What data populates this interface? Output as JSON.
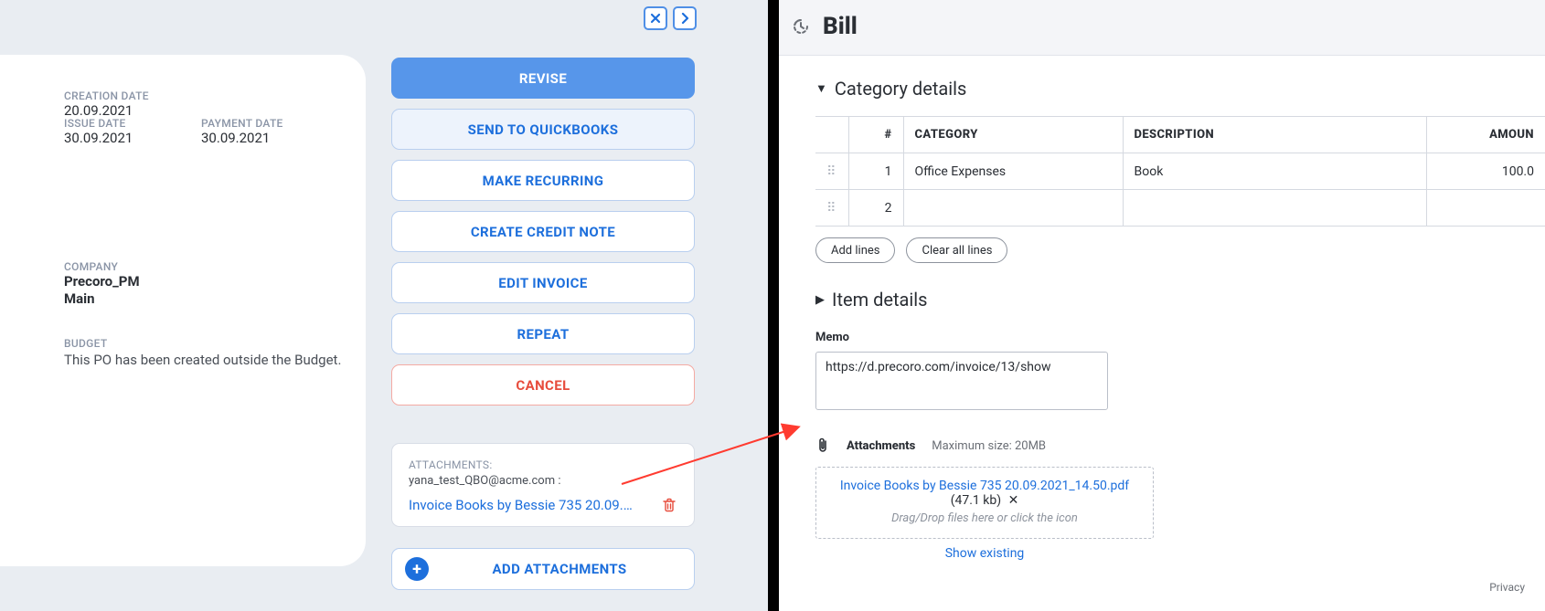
{
  "left": {
    "dates": {
      "creation_label": "CREATION DATE",
      "creation_value": "20.09.2021",
      "issue_label": "ISSUE DATE",
      "issue_value": "30.09.2021",
      "payment_label": "PAYMENT DATE",
      "payment_value": "30.09.2021"
    },
    "company_label": "COMPANY",
    "company_line1": "Precoro_PM",
    "company_line2": "Main",
    "budget_label": "BUDGET",
    "budget_text": "This PO has been created outside the Budget.",
    "actions": {
      "revise": "REVISE",
      "send_qb": "SEND TO QUICKBOOKS",
      "make_recurring": "MAKE RECURRING",
      "create_credit_note": "CREATE CREDIT NOTE",
      "edit_invoice": "EDIT INVOICE",
      "repeat": "REPEAT",
      "cancel": "CANCEL"
    },
    "attachments": {
      "title": "ATTACHMENTS:",
      "user": "yana_test_QBO@acme.com :",
      "file": "Invoice Books by Bessie 735 20.09.202...",
      "add_label": "ADD ATTACHMENTS"
    }
  },
  "right": {
    "title": "Bill",
    "category_title": "Category details",
    "table": {
      "headers": {
        "num": "#",
        "category": "CATEGORY",
        "description": "DESCRIPTION",
        "amount": "AMOUN"
      },
      "rows": [
        {
          "num": "1",
          "category": "Office Expenses",
          "description": "Book",
          "amount": "100.0"
        },
        {
          "num": "2",
          "category": "",
          "description": "",
          "amount": ""
        }
      ]
    },
    "add_lines": "Add lines",
    "clear_lines": "Clear all lines",
    "item_details": "Item details",
    "memo_label": "Memo",
    "memo_value": "https://d.precoro.com/invoice/13/show",
    "attachments_label": "Attachments",
    "max_size": "Maximum size: 20MB",
    "attach_file": "Invoice Books by Bessie 735 20.09.2021_14.50.pdf",
    "attach_size": " (47.1 kb) ",
    "attach_remove": "✕",
    "drop_hint": "Drag/Drop files here or click the icon",
    "show_existing": "Show existing",
    "privacy": "Privacy"
  }
}
